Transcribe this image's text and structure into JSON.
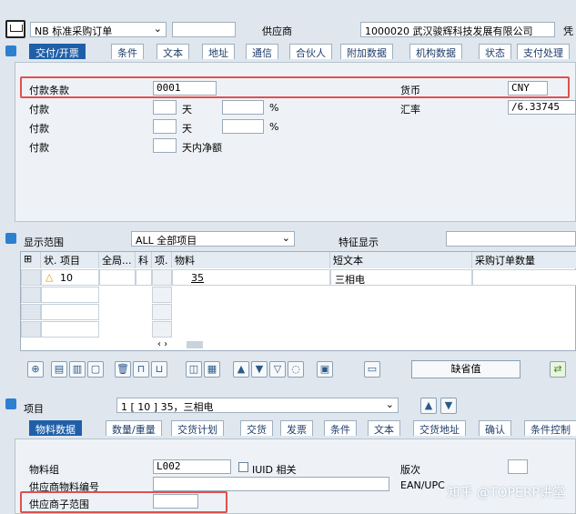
{
  "header": {
    "doc_type": "NB 标准采购订单",
    "vendor_label": "供应商",
    "vendor_value": "1000020 武汉骏辉科技发展有限公司",
    "extra_label": "凭"
  },
  "tabs": [
    "交付/开票",
    "条件",
    "文本",
    "地址",
    "通信",
    "合伙人",
    "附加数据",
    "机构数据",
    "状态",
    "支付处理"
  ],
  "payment": {
    "terms_label": "付款条款",
    "terms_value": "0001",
    "currency_label": "货币",
    "currency_value": "CNY",
    "rate_label": "汇率",
    "rate_value": "/6.33745",
    "pay1_label": "付款",
    "pay2_label": "付款",
    "pay3_label": "付款",
    "days1": "天",
    "days2": "天",
    "days3": "天内净额",
    "pct1": "%",
    "pct2": "%"
  },
  "items_overview": {
    "scope_label": "显示范围",
    "scope_value": "ALL 全部项目",
    "feature_label": "特征显示",
    "columns": [
      "状. 项目",
      "全局...",
      "科",
      "项.",
      "物料",
      "短文本",
      "采购订单数量"
    ],
    "row1": {
      "item": "10",
      "material": "35",
      "short_text": "三相电"
    },
    "default_btn": "缺省值"
  },
  "item_detail": {
    "label": "项目",
    "value": "1 [ 10 ] 35，三相电",
    "tabs": [
      "物料数据",
      "数量/重量",
      "交货计划",
      "交货",
      "发票",
      "条件",
      "文本",
      "交货地址",
      "确认",
      "条件控制"
    ],
    "material_group_label": "物料组",
    "material_group_value": "L002",
    "iuid_label": "IUID 相关",
    "version_label": "版次",
    "vendor_mat_label": "供应商物料编号",
    "ean_label": "EAN/UPC",
    "vendor_sub_label": "供应商子范围"
  },
  "watermark": "知乎 @TOPERP讲堂"
}
